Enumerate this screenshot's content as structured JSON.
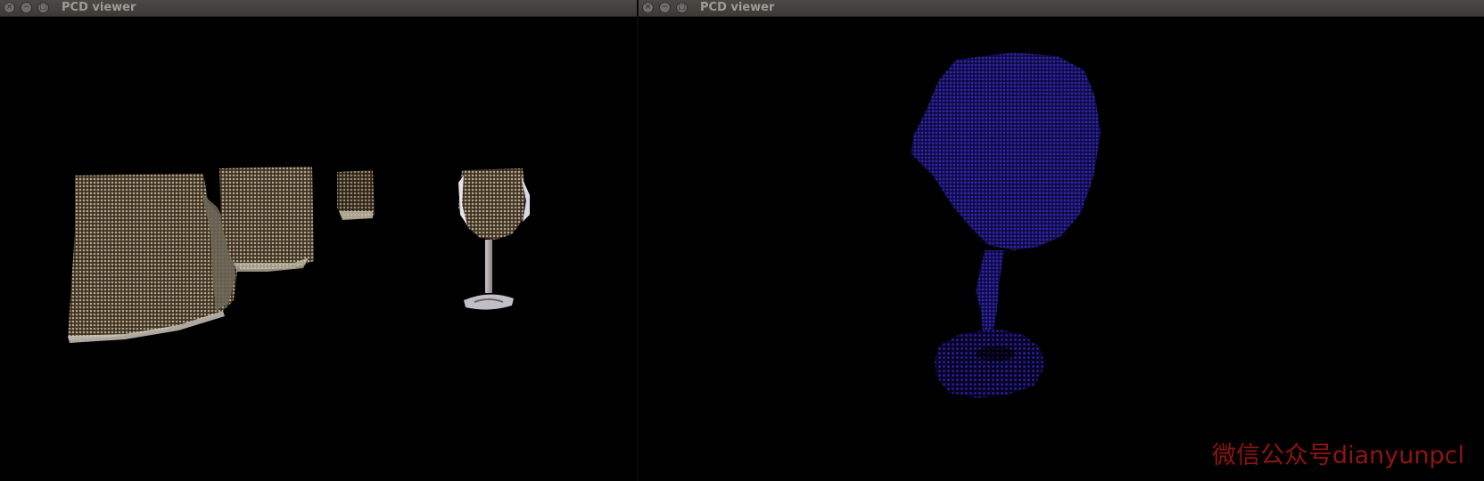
{
  "windows": [
    {
      "title": "PCD viewer"
    },
    {
      "title": "PCD viewer"
    }
  ],
  "titlebar_icons": {
    "close": "×",
    "minimize": "−",
    "maximize": "□"
  },
  "watermark": "微信公众号dianyunpcl",
  "colors": {
    "background": "#000000",
    "titlebar": "#3c3b37",
    "scene_points": "#a89878",
    "glass_highlight": "#d8d4e0",
    "cluster_points": "#2a1fa0",
    "watermark": "#8e1414"
  }
}
